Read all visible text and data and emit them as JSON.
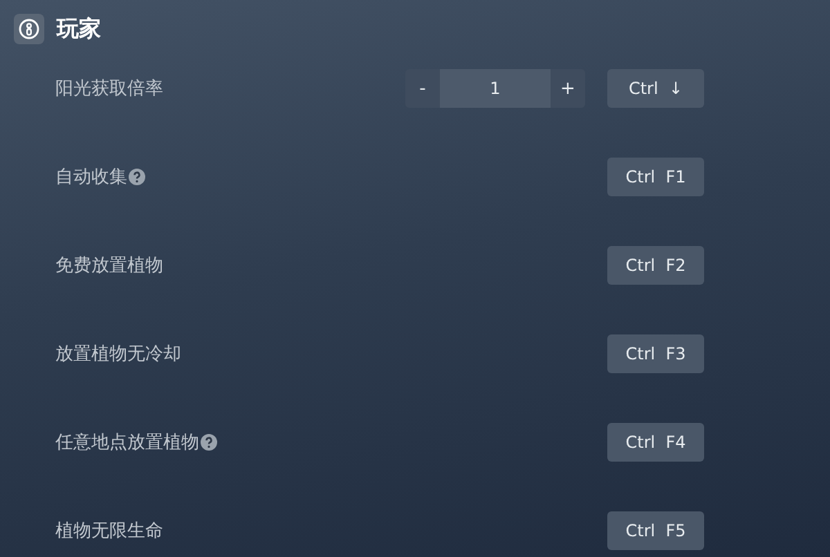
{
  "section": {
    "title": "玩家"
  },
  "items": [
    {
      "kind": "stepper",
      "label": "阳光获取倍率",
      "help": false,
      "minus": "-",
      "value": "1",
      "plus": "+",
      "hotkey": [
        "Ctrl",
        "↓"
      ]
    },
    {
      "kind": "toggle",
      "label": "自动收集",
      "help": true,
      "hotkey": [
        "Ctrl",
        "F1"
      ]
    },
    {
      "kind": "toggle",
      "label": "免费放置植物",
      "help": false,
      "hotkey": [
        "Ctrl",
        "F2"
      ]
    },
    {
      "kind": "toggle",
      "label": "放置植物无冷却",
      "help": false,
      "hotkey": [
        "Ctrl",
        "F3"
      ]
    },
    {
      "kind": "toggle",
      "label": "任意地点放置植物",
      "help": true,
      "hotkey": [
        "Ctrl",
        "F4"
      ]
    },
    {
      "kind": "toggle",
      "label": "植物无限生命",
      "help": false,
      "hotkey": [
        "Ctrl",
        "F5"
      ]
    }
  ]
}
